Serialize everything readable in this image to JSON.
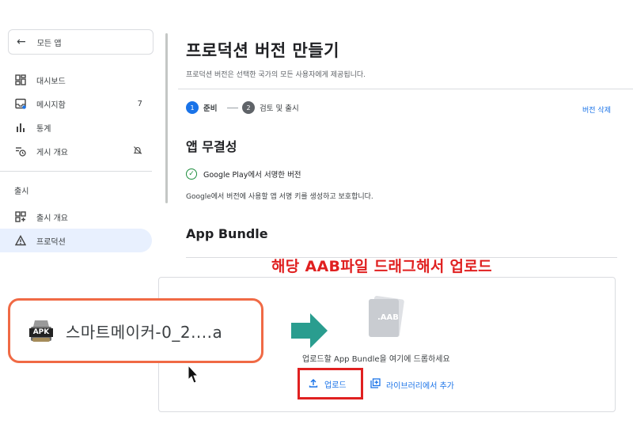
{
  "sidebar": {
    "back_label": "모든 앱",
    "items": [
      {
        "label": "대시보드",
        "badge": ""
      },
      {
        "label": "메시지함",
        "badge": "7"
      },
      {
        "label": "통계",
        "badge": ""
      },
      {
        "label": "게시 개요",
        "badge": ""
      }
    ],
    "section_label": "출시",
    "release_items": [
      {
        "label": "출시 개요"
      },
      {
        "label": "프로덕션"
      }
    ]
  },
  "main": {
    "title": "프로덕션 버전 만들기",
    "subtitle": "프로덕션 버전은 선택한 국가의 모든 사용자에게 제공됩니다.",
    "steps": [
      {
        "number": "1",
        "label": "준비"
      },
      {
        "number": "2",
        "label": "검토 및 출시"
      }
    ],
    "delete_link": "버전 삭제",
    "integrity": {
      "heading": "앱 무결성",
      "signed_label": "Google Play에서 서명한 버전",
      "description": "Google에서 버전에 사용할 앱 서명 키를 생성하고 보호합니다."
    },
    "bundle": {
      "heading": "App Bundle",
      "icon_label": ".AAB",
      "drop_text": "업로드할 App Bundle을 여기에 드롭하세요",
      "upload_label": "업로드",
      "library_label": "라이브러리에서 추가"
    }
  },
  "annotation": {
    "caption": "해당 AAB파일 드래그해서 업로드",
    "file_icon_label": "APK",
    "file_name": "스마트메이커-0_2....a"
  },
  "colors": {
    "accent": "#1a73e8",
    "annotation_red": "#e02020",
    "file_box_border": "#f06a45",
    "arrow": "#2a9d8f",
    "success": "#1e8e3e",
    "step_active": "#1a73e8",
    "step_inactive": "#5f6368"
  }
}
